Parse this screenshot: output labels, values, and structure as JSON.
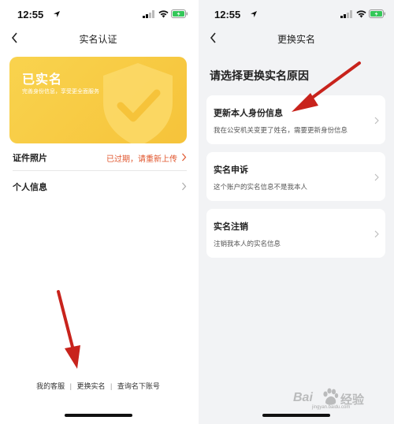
{
  "status_bar": {
    "time": "12:55"
  },
  "left_screen": {
    "nav_title": "实名认证",
    "card": {
      "title": "已实名",
      "subtitle": "完善身份信息，享受更全面服务"
    },
    "rows": [
      {
        "label": "证件照片",
        "value": "已过期，请重新上传"
      },
      {
        "label": "个人信息",
        "value": ""
      }
    ],
    "footer_links": [
      "我的客服",
      "更换实名",
      "查询名下账号"
    ],
    "footer_separator": "|"
  },
  "right_screen": {
    "nav_title": "更换实名",
    "heading": "请选择更换实名原因",
    "options": [
      {
        "title": "更新本人身份信息",
        "description": "我在公安机关变更了姓名，需要更新身份信息"
      },
      {
        "title": "实名申诉",
        "description": "这个账户的实名信息不是我本人"
      },
      {
        "title": "实名注销",
        "description": "注销我本人的实名信息"
      }
    ]
  },
  "watermark": {
    "brand": "Bai",
    "brand_cn": "经验",
    "url": "jingyan.baidu.com"
  },
  "colors": {
    "accent_yellow": "#f7c83f",
    "warning_red": "#e0562e",
    "annotation_red": "#c8231c",
    "right_bg": "#f2f3f5"
  }
}
